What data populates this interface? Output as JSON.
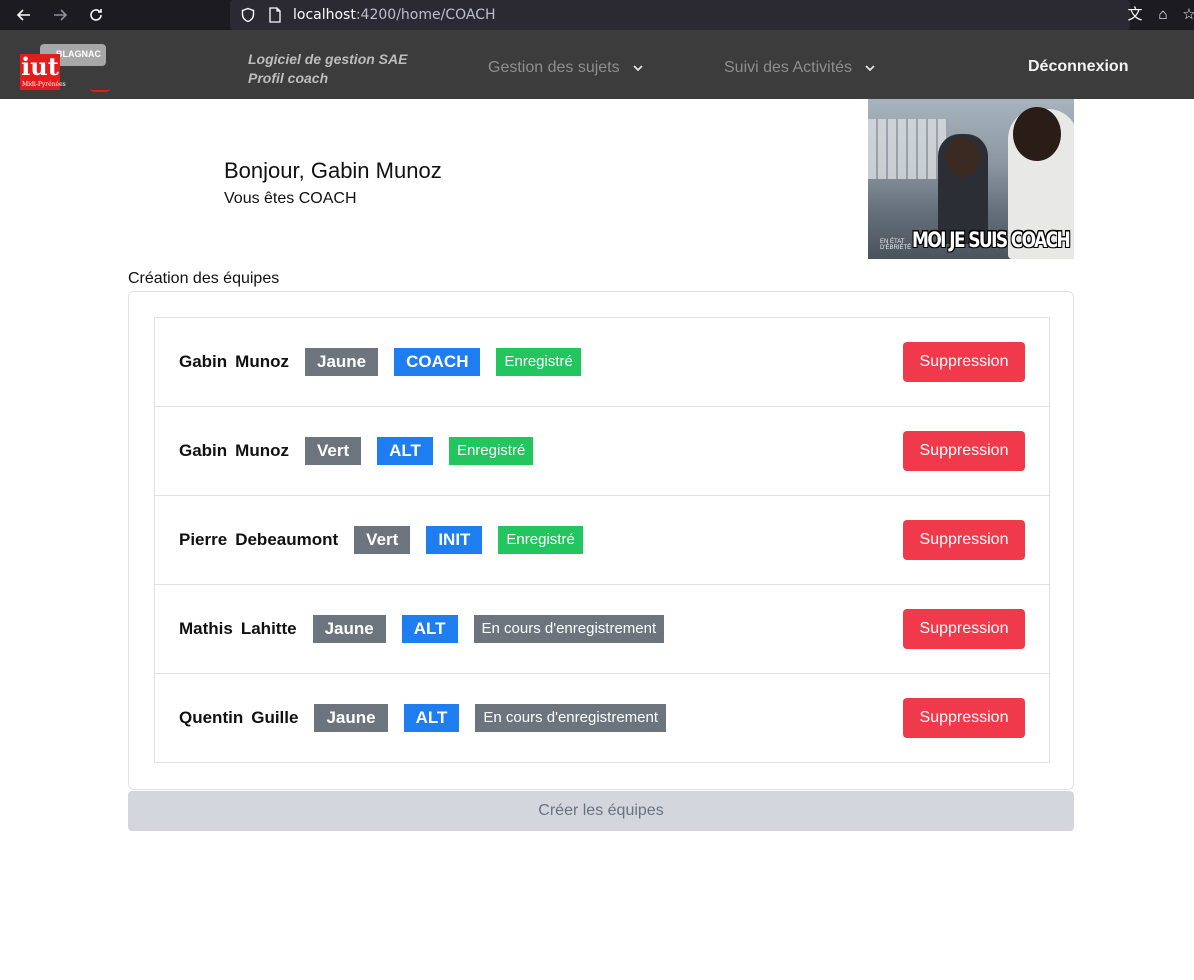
{
  "browser": {
    "url_host": "localhost",
    "url_rest": ":4200/home/COACH"
  },
  "navbar": {
    "logo_badge": "BLAGNAC",
    "logo_text": "iut",
    "logo_sub": "Midi-Pyrénées",
    "subtitle_line1": "Logiciel de gestion SAE",
    "subtitle_line2": "Profil coach",
    "menu_subjects": "Gestion des sujets",
    "menu_activities": "Suivi des Activités",
    "logout": "Déconnexion"
  },
  "greeting": {
    "hello": "Bonjour, Gabin Munoz",
    "role": "Vous êtes COACH"
  },
  "meme": {
    "caption": "MOI JE SUIS COACH",
    "watermark_line1": "EN ÉTAT",
    "watermark_line2": "D'ÉBRIÉTÉ"
  },
  "teams": {
    "title": "Création des équipes",
    "rows": [
      {
        "first": "Gabin",
        "last": "Munoz",
        "color": "Jaune",
        "role": "COACH",
        "status": "Enregistré",
        "status_ok": true,
        "action": "Suppression"
      },
      {
        "first": "Gabin",
        "last": "Munoz",
        "color": "Vert",
        "role": "ALT",
        "status": "Enregistré",
        "status_ok": true,
        "action": "Suppression"
      },
      {
        "first": "Pierre",
        "last": "Debeaumont",
        "color": "Vert",
        "role": "INIT",
        "status": "Enregistré",
        "status_ok": true,
        "action": "Suppression"
      },
      {
        "first": "Mathis",
        "last": "Lahitte",
        "color": "Jaune",
        "role": "ALT",
        "status": "En cours d'enregistrement",
        "status_ok": false,
        "action": "Suppression"
      },
      {
        "first": "Quentin",
        "last": "Guille",
        "color": "Jaune",
        "role": "ALT",
        "status": "En cours d'enregistrement",
        "status_ok": false,
        "action": "Suppression"
      }
    ],
    "create_button": "Créer les équipes"
  },
  "colors": {
    "danger": "#f0394a",
    "primary": "#1e7ef0",
    "success": "#22c55e",
    "secondary": "#6c757d"
  }
}
